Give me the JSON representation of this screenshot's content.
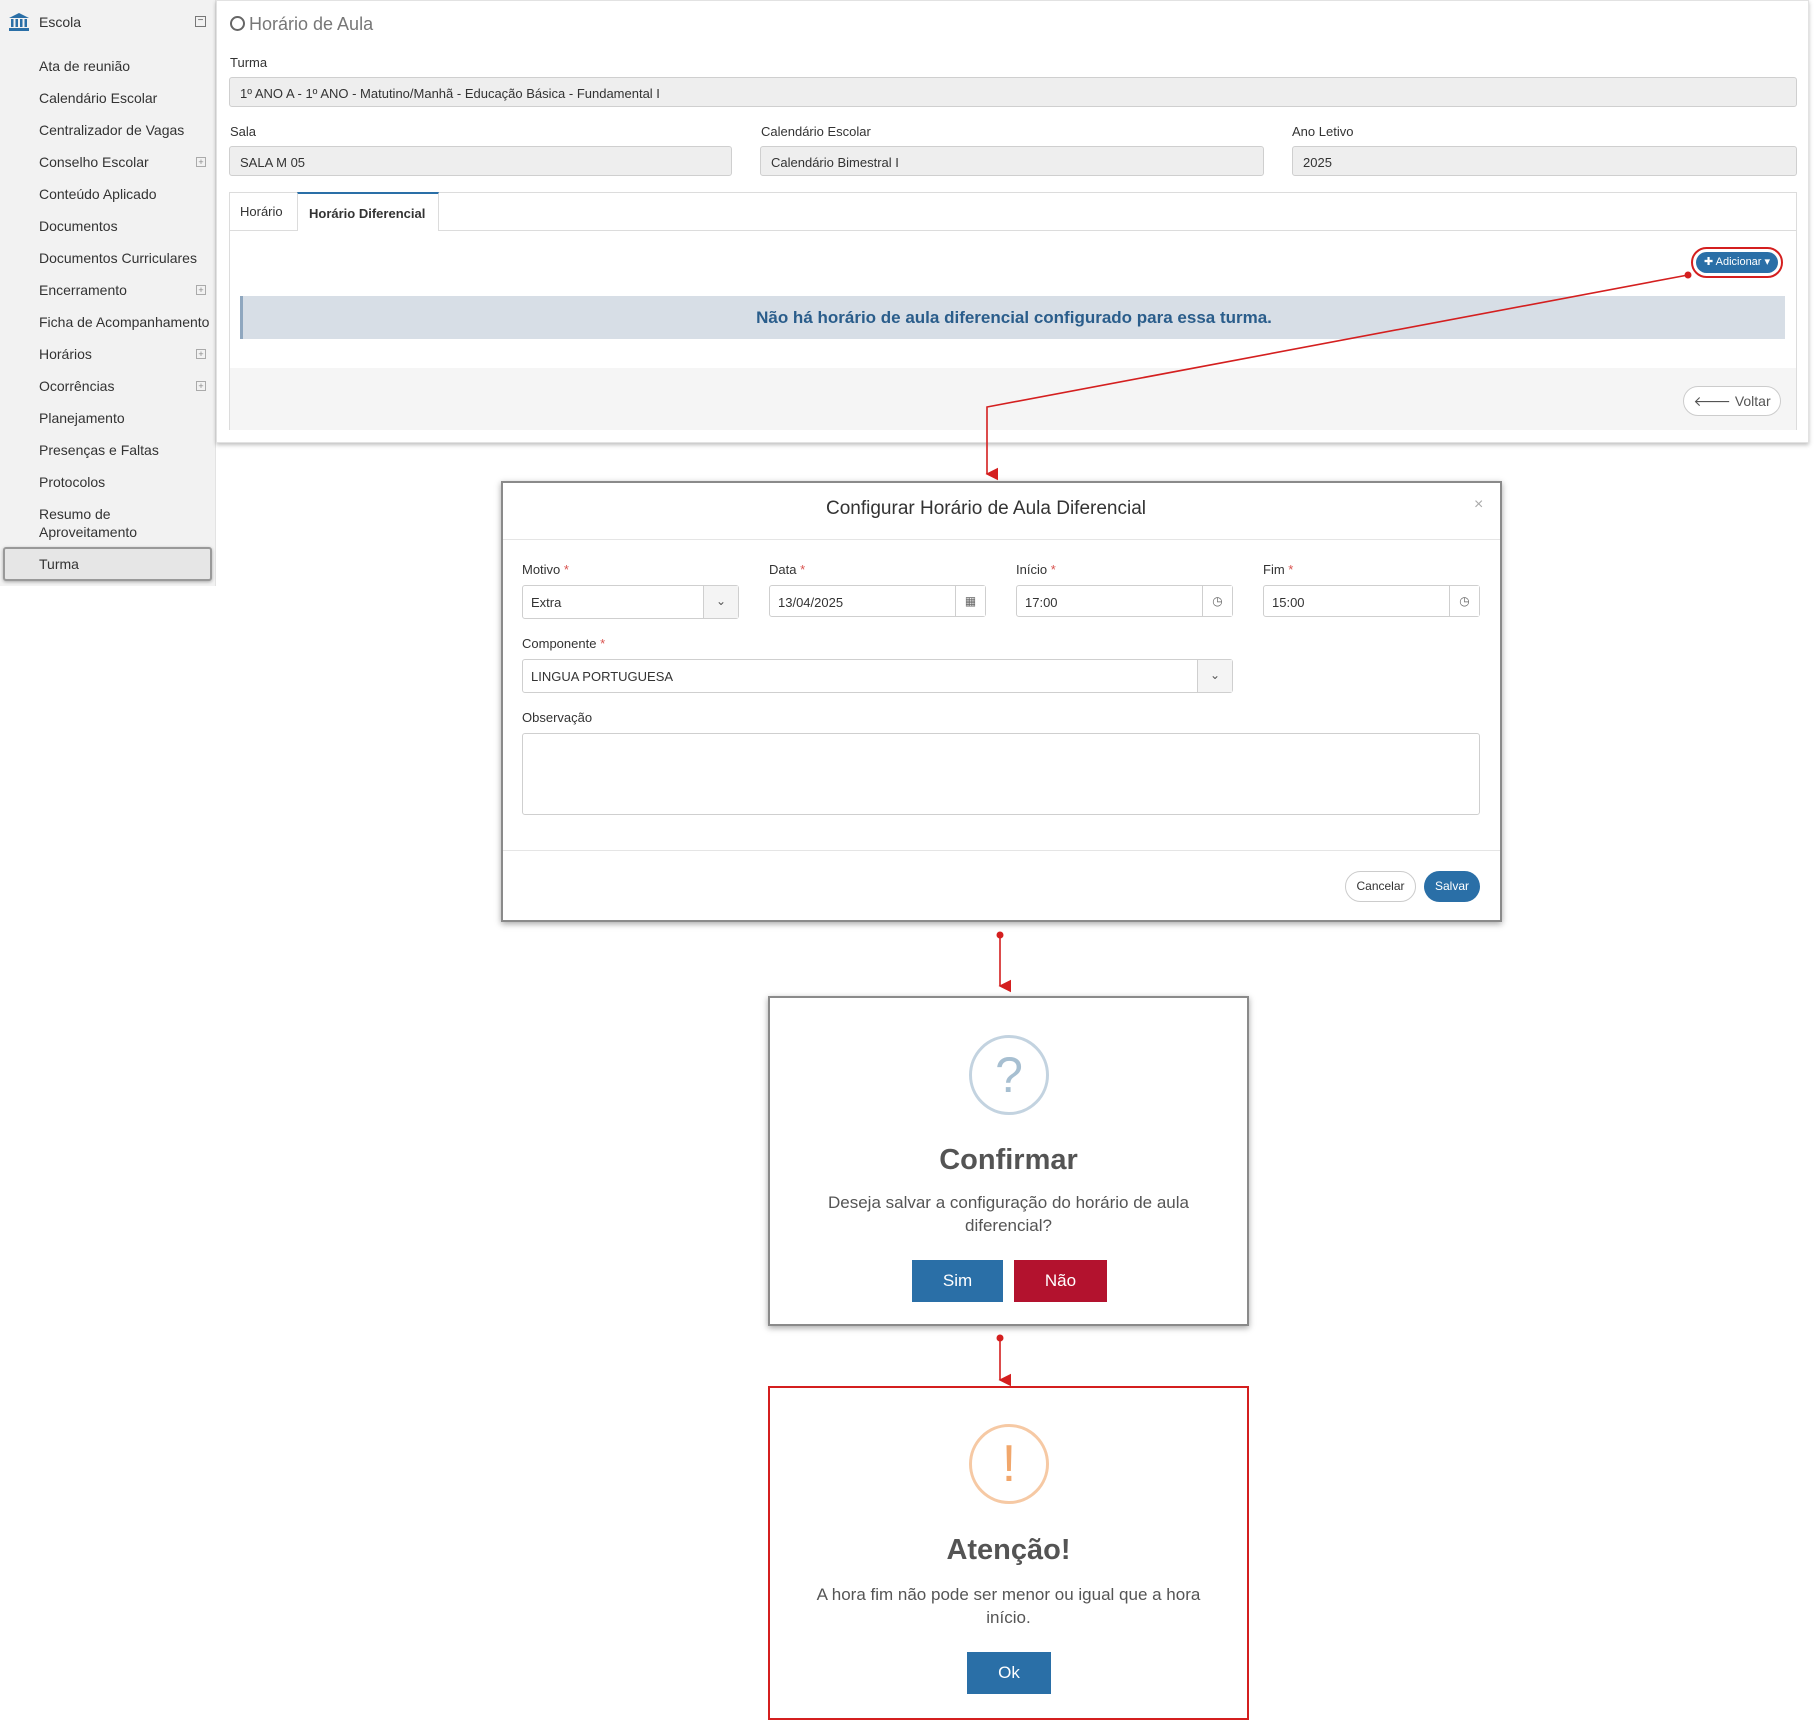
{
  "sidebar": {
    "title": "Escola",
    "items": [
      {
        "label": "Ata de reunião"
      },
      {
        "label": "Calendário Escolar"
      },
      {
        "label": "Centralizador de Vagas"
      },
      {
        "label": "Conselho Escolar"
      },
      {
        "label": "Conteúdo Aplicado"
      },
      {
        "label": "Documentos"
      },
      {
        "label": "Documentos Curriculares"
      },
      {
        "label": "Encerramento"
      },
      {
        "label": "Ficha de Acompanhamento"
      },
      {
        "label": "Horários"
      },
      {
        "label": "Ocorrências"
      },
      {
        "label": "Planejamento"
      },
      {
        "label": "Presenças e Faltas"
      },
      {
        "label": "Protocolos"
      },
      {
        "label_line1": "Resumo de",
        "label_line2": "Aproveitamento"
      },
      {
        "label": "Turma"
      }
    ]
  },
  "main": {
    "title": "Horário de Aula",
    "turma_label": "Turma",
    "turma_value": "1º ANO A - 1º ANO - Matutino/Manhã - Educação Básica - Fundamental I",
    "sala_label": "Sala",
    "sala_value": "SALA M 05",
    "calendario_label": "Calendário Escolar",
    "calendario_value": "Calendário Bimestral I",
    "ano_label": "Ano Letivo",
    "ano_value": "2025",
    "tabs": [
      {
        "label": "Horário"
      },
      {
        "label": "Horário Diferencial"
      }
    ],
    "add_button": "Adicionar",
    "empty_message": "Não há horário de aula diferencial configurado para essa turma.",
    "back_button": "Voltar"
  },
  "modal": {
    "title": "Configurar Horário de Aula Diferencial",
    "motivo_label": "Motivo",
    "motivo_value": "Extra",
    "data_label": "Data",
    "data_value": "13/04/2025",
    "inicio_label": "Início",
    "inicio_value": "17:00",
    "fim_label": "Fim",
    "fim_value": "15:00",
    "componente_label": "Componente",
    "componente_value": "LINGUA PORTUGUESA",
    "observacao_label": "Observação",
    "cancel_button": "Cancelar",
    "save_button": "Salvar"
  },
  "confirm": {
    "title": "Confirmar",
    "text": "Deseja salvar a configuração do horário de aula diferencial?",
    "yes_button": "Sim",
    "no_button": "Não"
  },
  "warning": {
    "title": "Atenção!",
    "text": "A hora fim não pode ser menor ou igual que a hora início.",
    "ok_button": "Ok"
  },
  "colors": {
    "primary": "#2a6fa7",
    "danger": "#b3122e",
    "annotation": "#d41f1f"
  }
}
